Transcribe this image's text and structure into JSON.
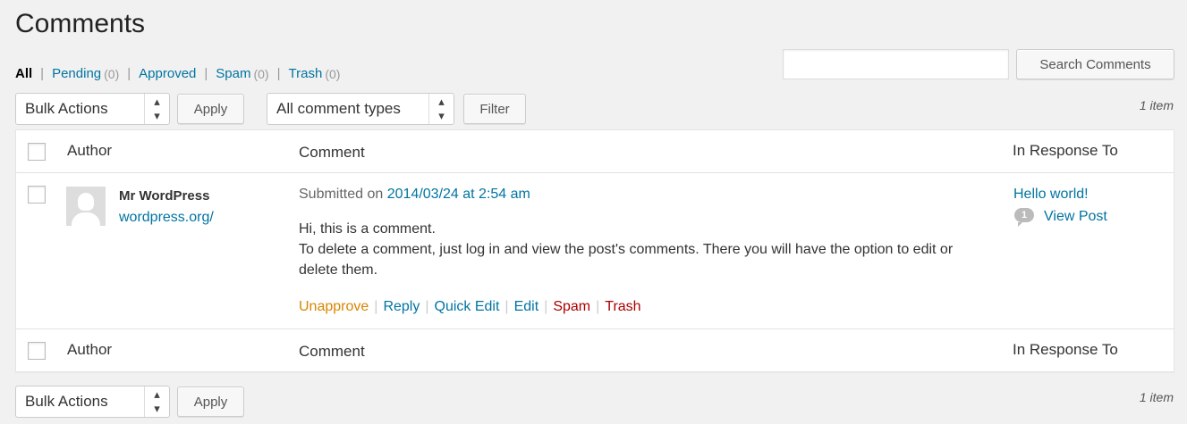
{
  "page": {
    "title": "Comments"
  },
  "status_filters": [
    {
      "label": "All",
      "count": ""
    },
    {
      "label": "Pending",
      "count": "(0)"
    },
    {
      "label": "Approved",
      "count": ""
    },
    {
      "label": "Spam",
      "count": "(0)"
    },
    {
      "label": "Trash",
      "count": "(0)"
    }
  ],
  "search": {
    "value": "",
    "button_label": "Search Comments"
  },
  "toolbar_top": {
    "bulk_actions": "Bulk Actions",
    "apply_label": "Apply",
    "comment_type": "All comment types",
    "filter_label": "Filter",
    "items_count": "1 item"
  },
  "table": {
    "columns": {
      "author": "Author",
      "comment": "Comment",
      "response": "In Response To"
    },
    "rows": [
      {
        "author_name": "Mr WordPress",
        "author_url": "wordpress.org/",
        "submitted_prefix": "Submitted on ",
        "submitted_date": "2014/03/24 at 2:54 am",
        "text_line1": "Hi, this is a comment.",
        "text_line2": "To delete a comment, just log in and view the post's comments. There you will have the option to edit or delete them.",
        "actions": {
          "unapprove": "Unapprove",
          "reply": "Reply",
          "quick_edit": "Quick Edit",
          "edit": "Edit",
          "spam": "Spam",
          "trash": "Trash"
        },
        "response_title": "Hello world!",
        "comment_count": "1",
        "view_post": "View Post"
      }
    ]
  },
  "toolbar_bottom": {
    "bulk_actions": "Bulk Actions",
    "apply_label": "Apply",
    "items_count": "1 item"
  },
  "colors": {
    "link": "#0074a2",
    "unapprove": "#d98500",
    "danger": "#aa0000",
    "background": "#f1f1f1"
  }
}
